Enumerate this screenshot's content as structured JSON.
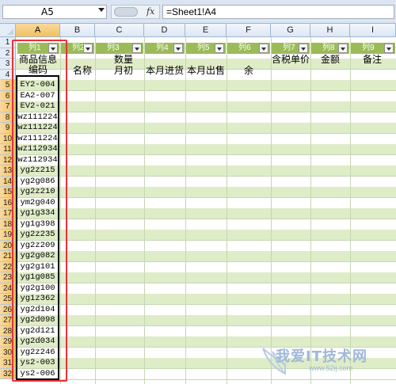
{
  "formula_bar": {
    "name_box": "A5",
    "fx_label": "fx",
    "formula": "=Sheet1!A4"
  },
  "columns": [
    "A",
    "B",
    "C",
    "D",
    "E",
    "F",
    "G",
    "H",
    "I"
  ],
  "rows": [
    "1",
    "2",
    "3",
    "4",
    "5",
    "6",
    "7",
    "8",
    "9",
    "10",
    "11",
    "12",
    "13",
    "14",
    "15",
    "16",
    "17",
    "18",
    "19",
    "20",
    "21",
    "22",
    "23",
    "24",
    "25",
    "26",
    "27",
    "28",
    "29",
    "30",
    "31",
    "32"
  ],
  "table_headers": [
    "列1",
    "列2",
    "列3",
    "列4",
    "列5",
    "列6",
    "列7",
    "列8",
    "列9"
  ],
  "row3": {
    "a_line1": "商品信息",
    "a_line2": "编码",
    "c_line1": "数量",
    "g": "含税单价",
    "h": "金额",
    "i": "备注"
  },
  "row4": {
    "b": "名称",
    "c": "月初",
    "d": "本月进货",
    "e": "本月出售",
    "f": "余"
  },
  "codes": [
    "EY2-004",
    "EA2-007",
    "EV2-021",
    "wz111224",
    "wz111224",
    "wz111224",
    "wz112934",
    "wz112934",
    "yg2z215",
    "yg2g086",
    "yg2z210",
    "ym2g040",
    "yg1g334",
    "yg1g398",
    "yg2z235",
    "yg2z209",
    "yg2g082",
    "yg2g101",
    "yg1g085",
    "yg2g100",
    "yg1z362",
    "yg2d104",
    "yg2d098",
    "yg2d121",
    "yg2d034",
    "yg2z246",
    "ys2-003",
    "ys2-006"
  ],
  "watermark": {
    "text": "我爱IT技术网",
    "url": "www.52ij.com"
  }
}
